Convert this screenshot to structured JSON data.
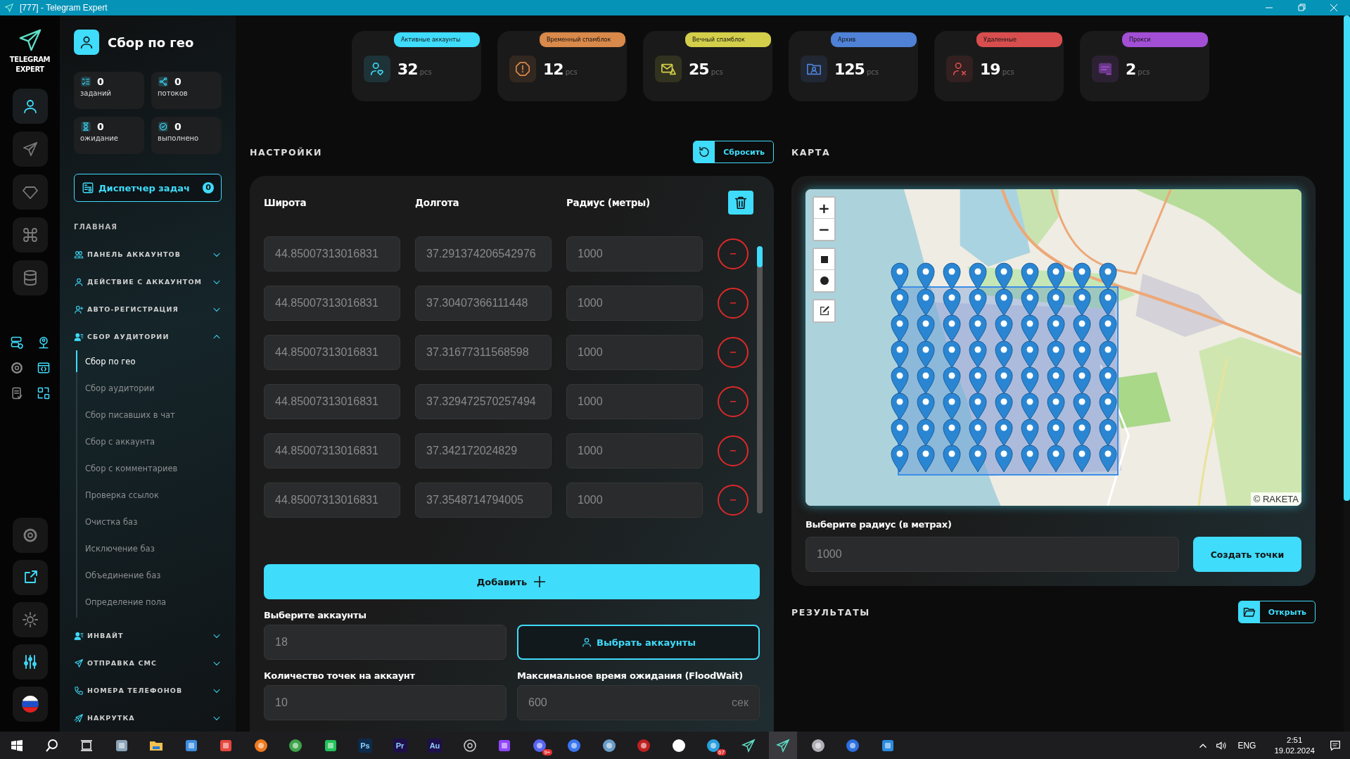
{
  "window": {
    "title": "[777] - Telegram Expert"
  },
  "brand": {
    "name": "TELEGRAM EXPERT"
  },
  "rail": {
    "items": [
      {
        "selected": true
      },
      {
        "selected": false
      },
      {
        "selected": false
      },
      {
        "selected": false
      },
      {
        "selected": false
      }
    ]
  },
  "page_header": {
    "title": "Сбор по гео"
  },
  "counters": [
    {
      "value": "0",
      "label": "заданий"
    },
    {
      "value": "0",
      "label": "потоков"
    },
    {
      "value": "0",
      "label": "ожидание"
    },
    {
      "value": "0",
      "label": "выполнено"
    }
  ],
  "task_manager": {
    "label": "Диспетчер задач",
    "count": "0"
  },
  "nav": {
    "heading": "ГЛАВНАЯ",
    "sections": [
      {
        "label": "ПАНЕЛЬ АККАУНТОВ",
        "expanded": false
      },
      {
        "label": "ДЕЙСТВИЕ С АККАУНТОМ",
        "expanded": false
      },
      {
        "label": "АВТО-РЕГИСТРАЦИЯ",
        "expanded": false
      },
      {
        "label": "СБОР АУДИТОРИИ",
        "expanded": true,
        "children": [
          {
            "label": "Сбор по гео",
            "selected": true
          },
          {
            "label": "Сбор аудитории",
            "selected": false
          },
          {
            "label": "Сбор писавших в чат",
            "selected": false
          },
          {
            "label": "Сбор с аккаунта",
            "selected": false
          },
          {
            "label": "Сбор с комментариев",
            "selected": false
          },
          {
            "label": "Проверка ссылок",
            "selected": false
          },
          {
            "label": "Очистка баз",
            "selected": false
          },
          {
            "label": "Исключение баз",
            "selected": false
          },
          {
            "label": "Объединение баз",
            "selected": false
          },
          {
            "label": "Определение пола",
            "selected": false
          }
        ]
      },
      {
        "label": "ИНВАЙТ",
        "expanded": false
      },
      {
        "label": "ОТПРАВКА СМС",
        "expanded": false
      },
      {
        "label": "НОМЕРА ТЕЛЕФОНОВ",
        "expanded": false
      },
      {
        "label": "НАКРУТКА",
        "expanded": false
      }
    ]
  },
  "stats": [
    {
      "label": "Активные аккаунты",
      "value": "32",
      "unit": "pcs",
      "color": "#3fdcfb"
    },
    {
      "label": "Временный спамблок",
      "value": "12",
      "unit": "pcs",
      "color": "#d9894a"
    },
    {
      "label": "Вечный спамблок",
      "value": "25",
      "unit": "pcs",
      "color": "#d3cf4a"
    },
    {
      "label": "Архив",
      "value": "125",
      "unit": "pcs",
      "color": "#4f82d6"
    },
    {
      "label": "Удаленные",
      "value": "19",
      "unit": "pcs",
      "color": "#d84e4e"
    },
    {
      "label": "Прокси",
      "value": "2",
      "unit": "pcs",
      "color": "#a24fd6"
    }
  ],
  "settings": {
    "heading": "НАСТРОЙКИ",
    "reset_button": "Сбросить",
    "columns": [
      "Широта",
      "Долгота",
      "Радиус (метры)"
    ],
    "rows": [
      {
        "latitude": "44.85007313016831",
        "longitude": "37.291374206542976",
        "radius": "1000"
      },
      {
        "latitude": "44.85007313016831",
        "longitude": "37.30407366111448",
        "radius": "1000"
      },
      {
        "latitude": "44.85007313016831",
        "longitude": "37.31677311568598",
        "radius": "1000"
      },
      {
        "latitude": "44.85007313016831",
        "longitude": "37.329472570257494",
        "radius": "1000"
      },
      {
        "latitude": "44.85007313016831",
        "longitude": "37.342172024829",
        "radius": "1000"
      },
      {
        "latitude": "44.85007313016831",
        "longitude": "37.3548714794005",
        "radius": "1000"
      }
    ],
    "add_button": "Добавить",
    "accounts": {
      "label": "Выберите аккаунты",
      "value": "18",
      "button": "Выбрать аккаунты"
    },
    "points": {
      "label": "Количество точек на аккаунт",
      "value": "10"
    },
    "floodwait": {
      "label": "Максимальное время ожидания (FloodWait)",
      "value": "600",
      "unit": "сек"
    }
  },
  "map": {
    "heading": "КАРТА",
    "zoom_in": "+",
    "zoom_out": "−",
    "attribution": "© RAKETA",
    "radius_label": "Выберите радиус (в метрах)",
    "radius_value": "1000",
    "create_button": "Создать точки"
  },
  "results": {
    "heading": "РЕЗУЛЬТАТЫ",
    "open_button": "Открыть"
  },
  "taskbar": {
    "apps": [
      {
        "selected": false
      },
      {
        "selected": false
      },
      {
        "selected": false
      },
      {
        "selected": false
      },
      {
        "selected": false
      },
      {
        "selected": false
      },
      {
        "selected": false
      },
      {
        "selected": false
      },
      {
        "selected": false
      },
      {
        "selected": false
      },
      {
        "label": "Ps",
        "selected": false
      },
      {
        "label": "Pr",
        "selected": false
      },
      {
        "label": "Au",
        "selected": false
      },
      {
        "selected": false
      },
      {
        "selected": false
      },
      {
        "badge": "9+",
        "selected": false
      },
      {
        "selected": false
      },
      {
        "selected": false
      },
      {
        "selected": false
      },
      {
        "selected": false
      },
      {
        "badge": "67",
        "selected": false
      },
      {
        "selected": false
      },
      {
        "selected": true
      },
      {
        "selected": false
      },
      {
        "selected": false
      },
      {
        "selected": false
      }
    ],
    "language": "ENG",
    "time": "2:51",
    "date": "19.02.2024"
  }
}
